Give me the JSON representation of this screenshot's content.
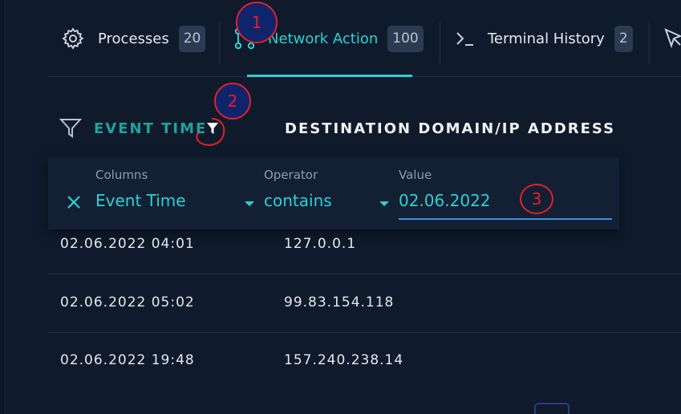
{
  "tabs": [
    {
      "label": "Processes",
      "count": "20",
      "icon": "gear-icon"
    },
    {
      "label": "Network Action",
      "count": "100",
      "icon": "network-icon",
      "active": true
    },
    {
      "label": "Terminal History",
      "count": "2",
      "icon": "terminal-icon"
    },
    {
      "icon": "cursor-icon"
    }
  ],
  "table": {
    "headers": [
      "EVENT TIME",
      "DESTINATION DOMAIN/IP ADDRESS"
    ],
    "rows": [
      [
        "02.06.2022 04:01",
        "127.0.0.1"
      ],
      [
        "02.06.2022 05:02",
        "99.83.154.118"
      ],
      [
        "02.06.2022 19:48",
        "157.240.238.14"
      ]
    ]
  },
  "filter": {
    "columns_label": "Columns",
    "columns_value": "Event Time",
    "operator_label": "Operator",
    "operator_value": "contains",
    "value_label": "Value",
    "value": "02.06.2022"
  },
  "annotations": [
    "1",
    "2",
    "3"
  ],
  "colors": {
    "accent": "#2ed0d6",
    "header_teal": "#1fa39a",
    "annotation_red": "#e0202a",
    "annotation_fill": "#10246b",
    "background": "#0f1b2b"
  }
}
